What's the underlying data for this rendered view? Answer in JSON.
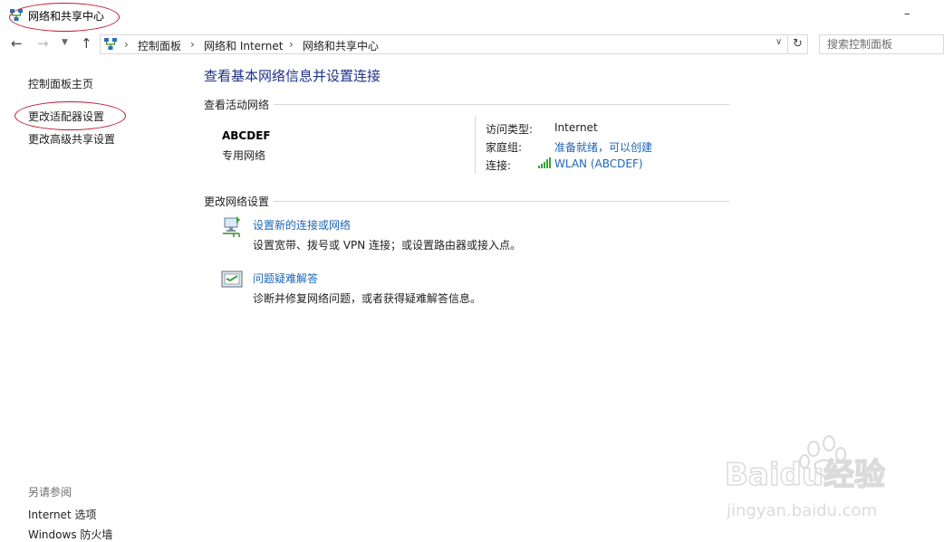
{
  "window": {
    "title": "网络和共享中心",
    "minimize_glyph": "–"
  },
  "address_bar": {
    "breadcrumbs": [
      "控制面板",
      "网络和 Internet",
      "网络和共享中心"
    ],
    "separator": "›",
    "search_placeholder": "搜索控制面板"
  },
  "left_pane": {
    "home_link": "控制面板主页",
    "links": [
      "更改适配器设置",
      "更改高级共享设置"
    ],
    "see_also_header": "另请参阅",
    "see_also_links": [
      "Internet 选项",
      "Windows 防火墙"
    ]
  },
  "main": {
    "title": "查看基本网络信息并设置连接",
    "active_header": "查看活动网络",
    "network": {
      "name": "ABCDEF",
      "type": "专用网络",
      "access_type_label": "访问类型:",
      "access_type_value": "Internet",
      "homegroup_label": "家庭组:",
      "homegroup_value": "准备就绪，可以创建",
      "connection_label": "连接:",
      "connection_value": "WLAN (ABCDEF)"
    },
    "change_header": "更改网络设置",
    "tasks": [
      {
        "link": "设置新的连接或网络",
        "desc": "设置宽带、拨号或 VPN 连接；或设置路由器或接入点。",
        "icon": "new-connection-icon"
      },
      {
        "link": "问题疑难解答",
        "desc": "诊断并修复网络问题，或者获得疑难解答信息。",
        "icon": "troubleshoot-icon"
      }
    ]
  },
  "watermark": {
    "brand": "Baidu经验",
    "url": "jingyan.baidu.com"
  },
  "colors": {
    "link": "#1e66b4",
    "title": "#1e3287",
    "annotation": "#c0172b"
  }
}
